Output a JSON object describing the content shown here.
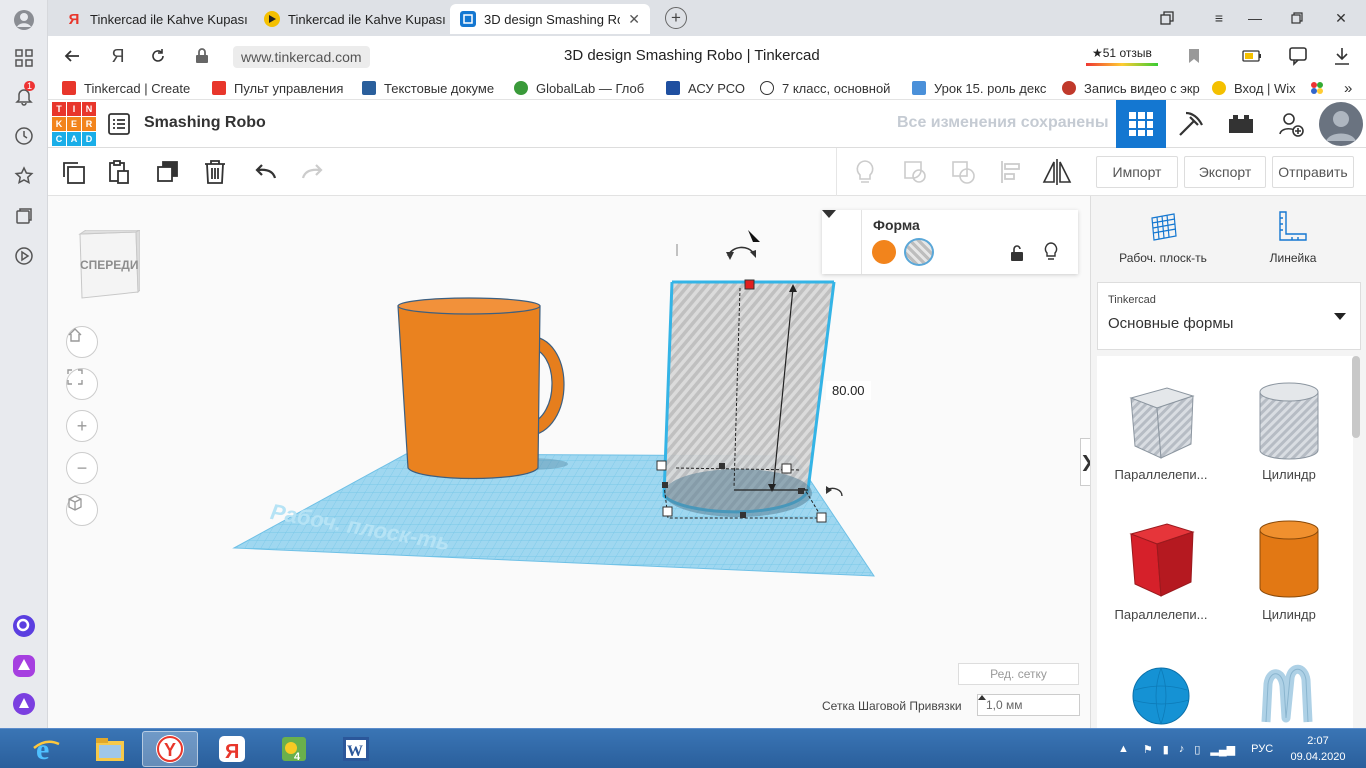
{
  "browser": {
    "tabs": [
      {
        "title": "Tinkercad ile Kahve Kupası",
        "favicon_color": "#e8362b"
      },
      {
        "title": "Tinkercad ile Kahve Kupası",
        "favicon_color": "#f4c000"
      },
      {
        "title": "3D design Smashing Robo | Tinkercad",
        "favicon_color": "#1477d1",
        "active": true
      }
    ],
    "url": "www.tinkercad.com",
    "page_title": "3D design Smashing Robo | Tinkercad",
    "reviews": "★51 отзыв",
    "notification_count": "1"
  },
  "bookmarks": [
    {
      "label": "Tinkercad | Create",
      "color": "#e8362b"
    },
    {
      "label": "Пульт управления",
      "color": "#e8362b"
    },
    {
      "label": "Текстовые докуме",
      "color": "#2a5f9c"
    },
    {
      "label": "GlobalLab — Глоб",
      "color": "#3a9a3a"
    },
    {
      "label": "АСУ РСО",
      "color": "#1f4fa0"
    },
    {
      "label": "7 класс, основной",
      "color": "#333333"
    },
    {
      "label": "Урок 15. роль декс",
      "color": "#4a90d9"
    },
    {
      "label": "Запись видео с экр",
      "color": "#c0392b"
    },
    {
      "label": "Вход | Wix",
      "color": "#f4c000"
    }
  ],
  "tinkercad": {
    "logo_letters": [
      "T",
      "I",
      "N",
      "K",
      "E",
      "R",
      "C",
      "A",
      "D"
    ],
    "project_name": "Smashing Robo",
    "saved_status": "Все изменения сохранены"
  },
  "toolbar": {
    "import_label": "Импорт",
    "export_label": "Экспорт",
    "send_label": "Отправить"
  },
  "viewport": {
    "viewcube_label": "СПЕРЕДИ",
    "dimension_value": "80.00",
    "workplane_label": "Рабоч. плоск-ть",
    "edit_grid_label": "Ред. сетку",
    "snap_grid_label": "Сетка Шаговой Привязки",
    "snap_grid_value": "1,0 мм"
  },
  "inspector": {
    "title": "Форма",
    "solid_color": "#f2841c",
    "hole_label": "hole"
  },
  "right_panel": {
    "workplane_tool": "Рабоч. плоск-ть",
    "ruler_tool": "Линейка",
    "library_source": "Tinkercad",
    "library_name": "Основные формы",
    "shapes": [
      {
        "label": "Параллелепи...",
        "kind": "box-hole"
      },
      {
        "label": "Цилиндр",
        "kind": "cylinder-hole"
      },
      {
        "label": "Параллелепи...",
        "kind": "box-red"
      },
      {
        "label": "Цилиндр",
        "kind": "cylinder-orange"
      },
      {
        "label": "",
        "kind": "sphere-blue"
      },
      {
        "label": "",
        "kind": "scribble"
      }
    ]
  },
  "taskbar": {
    "language": "РУС",
    "time": "2:07",
    "date": "09.04.2020"
  }
}
